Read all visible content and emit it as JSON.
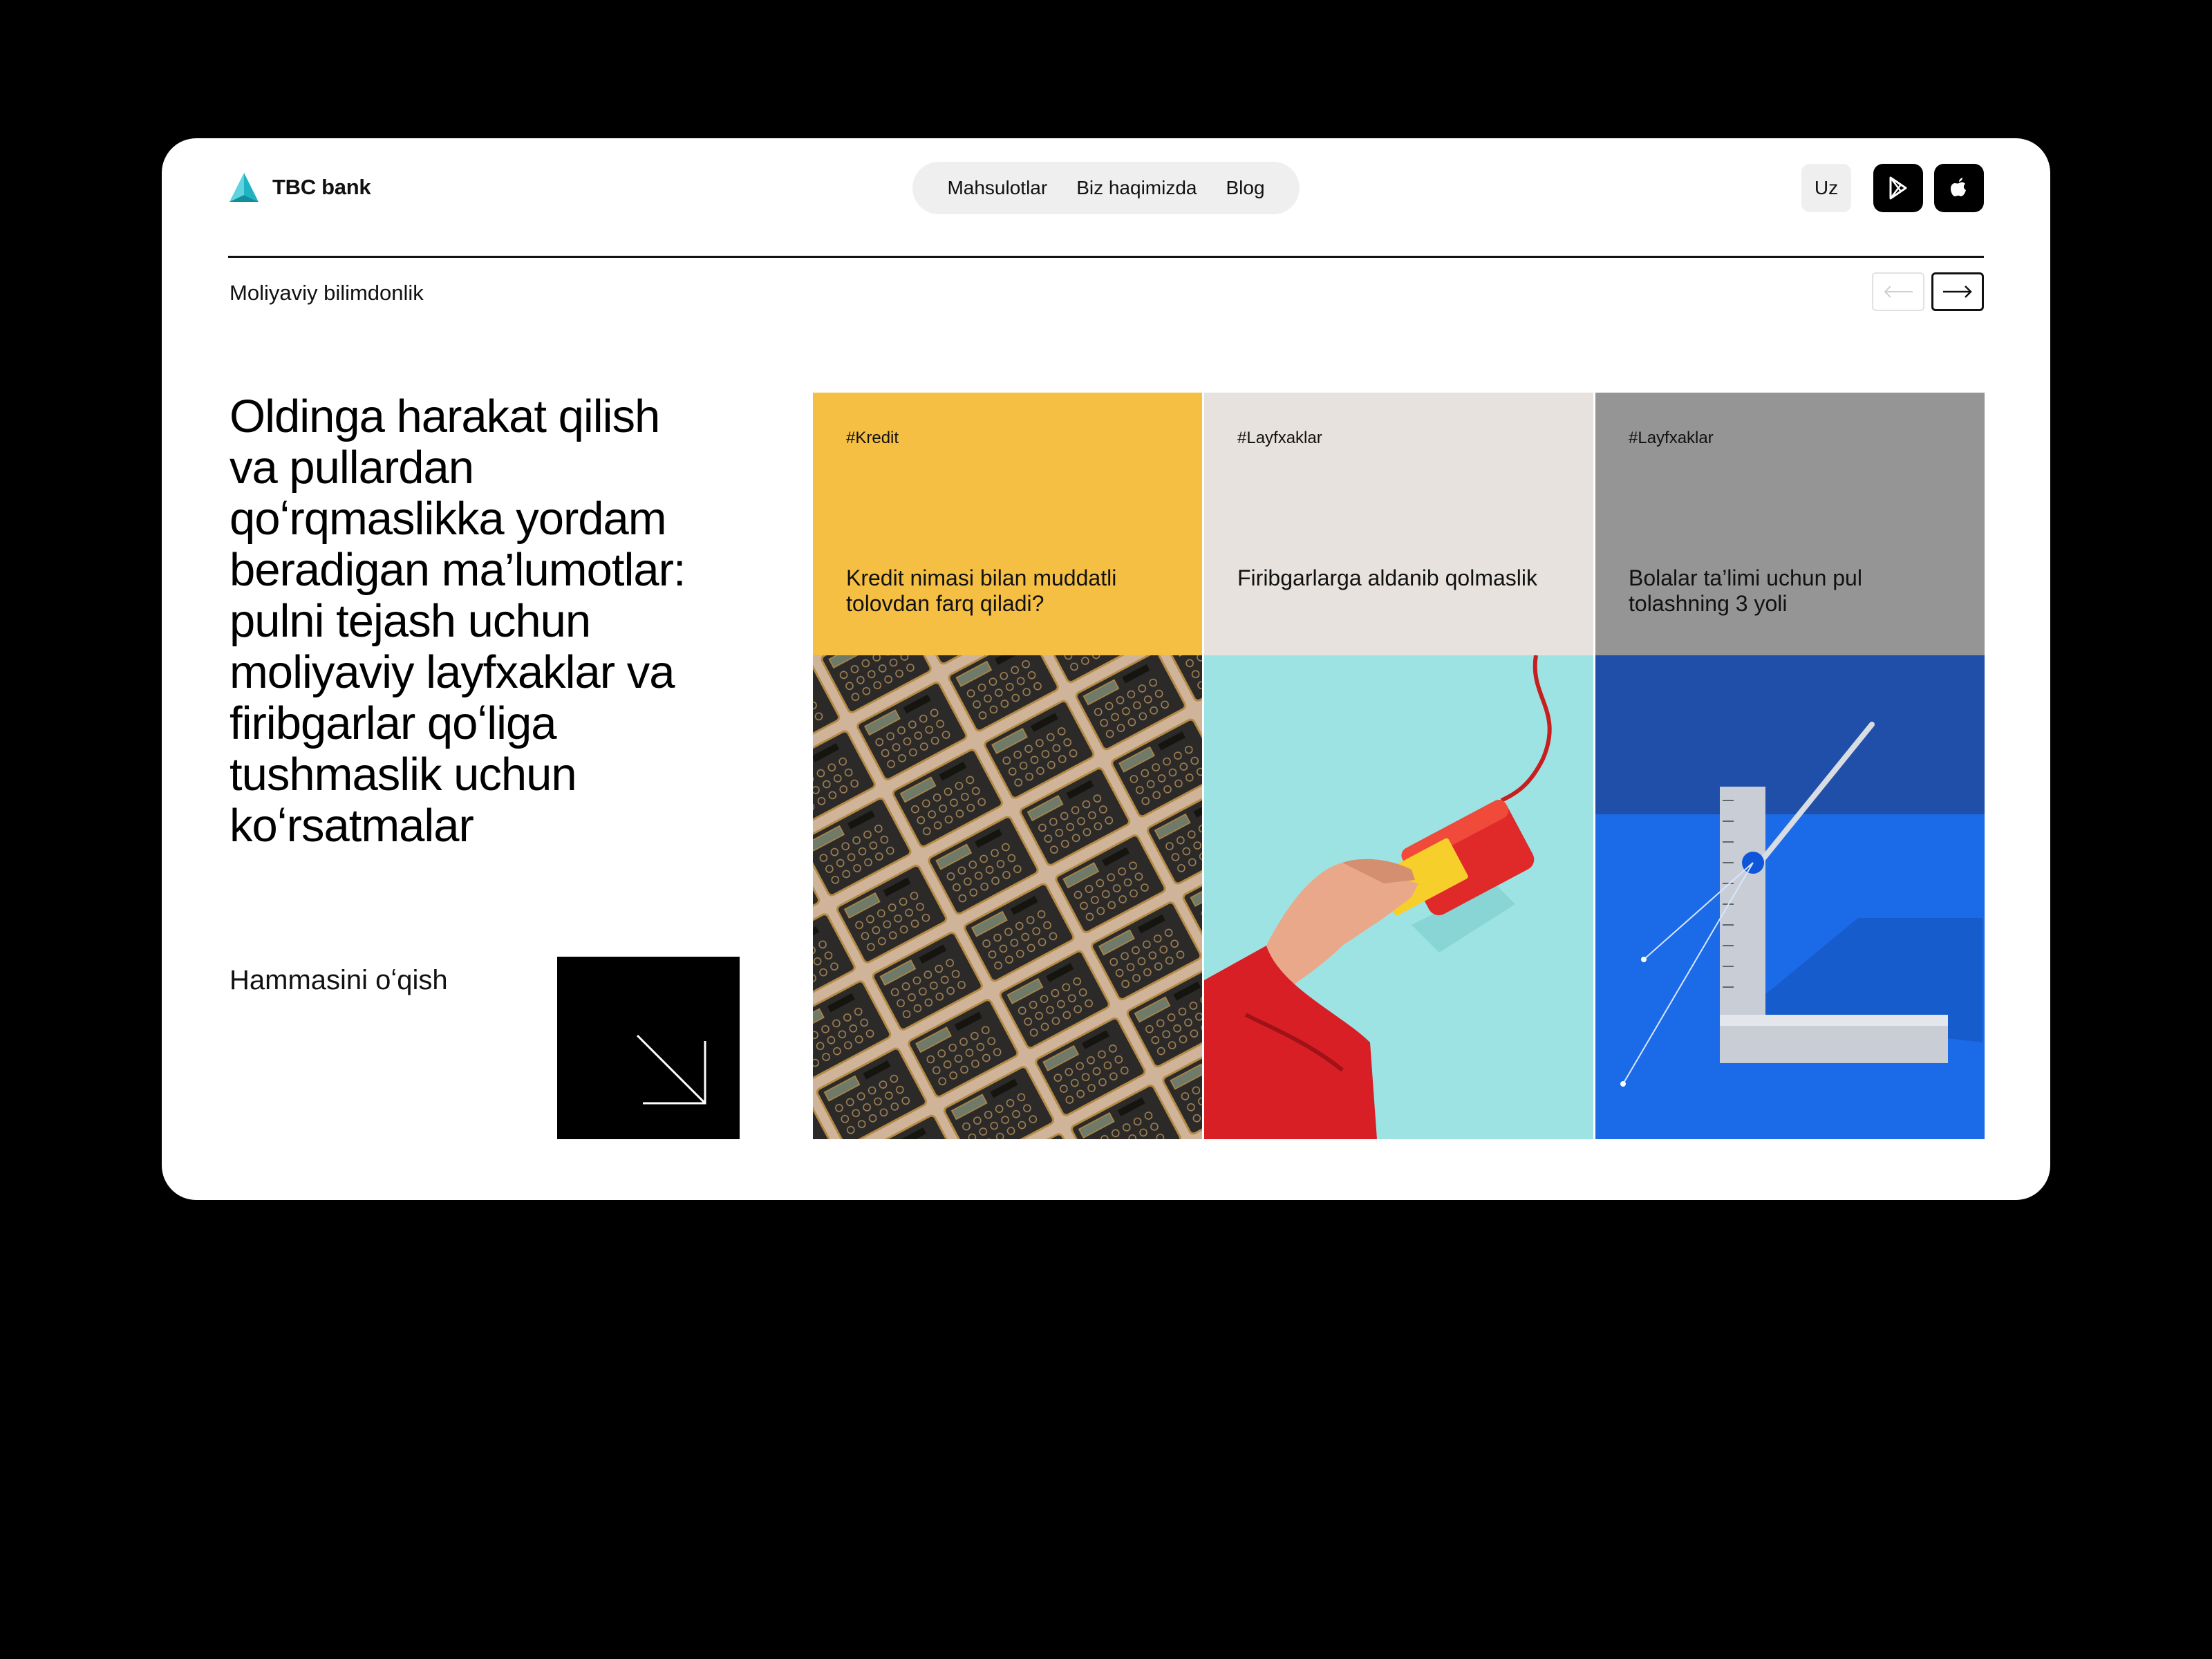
{
  "brand": {
    "name": "TBC bank",
    "accent": "#22b5c8"
  },
  "nav": {
    "items": [
      "Mahsulotlar",
      "Biz haqimizda",
      "Blog"
    ]
  },
  "header": {
    "language": "Uz",
    "play_store_icon": "play-store-icon",
    "app_store_icon": "apple-icon"
  },
  "section": {
    "label": "Moliyaviy bilimdonlik"
  },
  "hero": {
    "headline": "Oldinga harakat qilish va pullardan qoʻrqmaslikka yordam beradigan ma’lumotlar: pulni tejash uchun moliyaviy layfxaklar va firibgarlar qoʻliga tushmaslik uchun koʻrsatmalar",
    "read_all": "Hammasini oʻqish"
  },
  "cards": [
    {
      "tag": "#Kredit",
      "title": "Kredit nimasi bilan muddatli tolovdan farq qiladi?",
      "color": "#f5bf43",
      "image": "calculators-image"
    },
    {
      "tag": "#Layfxaklar",
      "title": "Firibgarlarga aldanib qolmaslik",
      "color": "#e7e2dd",
      "image": "hand-card-reader-image"
    },
    {
      "tag": "#Layfxaklar",
      "title": "Bolalar ta’limi uchun pul tolashning 3 yoli",
      "color": "#959595",
      "image": "ruler-pen-image"
    }
  ],
  "colors": {
    "page_bg": "#000000",
    "window_bg": "#ffffff",
    "nav_bg": "#efefef"
  }
}
